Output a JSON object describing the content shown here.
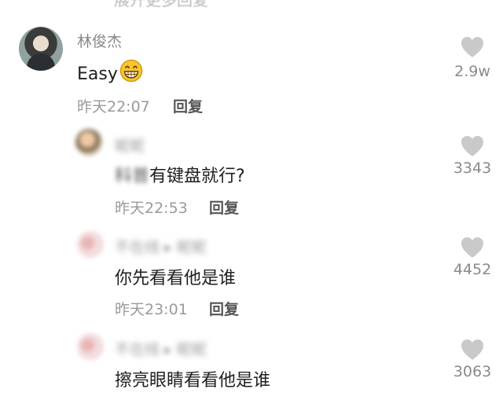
{
  "top_cut_text": "展开更多回复",
  "main_comment": {
    "username": "林俊杰",
    "text": "Easy",
    "emoji_icon": "grinning-face-emoji",
    "time": "昨天22:07",
    "reply_label": "回复",
    "like_count": "2.9w"
  },
  "replies": [
    {
      "username": "昵昵",
      "text_blurred_prefix": "科普",
      "text": "有键盘就行?",
      "time": "昨天22:53",
      "reply_label": "回复",
      "like_count": "3343"
    },
    {
      "username": "不在线 ▸ 昵昵",
      "text": "你先看看他是谁",
      "time": "昨天23:01",
      "reply_label": "回复",
      "like_count": "4452"
    },
    {
      "username": "不在线 ▸ 昵昵",
      "text": "擦亮眼睛看看他是谁",
      "like_count": "3063"
    }
  ],
  "colors": {
    "heart": "#c9c9c9",
    "emoji": "#f7c52f"
  }
}
